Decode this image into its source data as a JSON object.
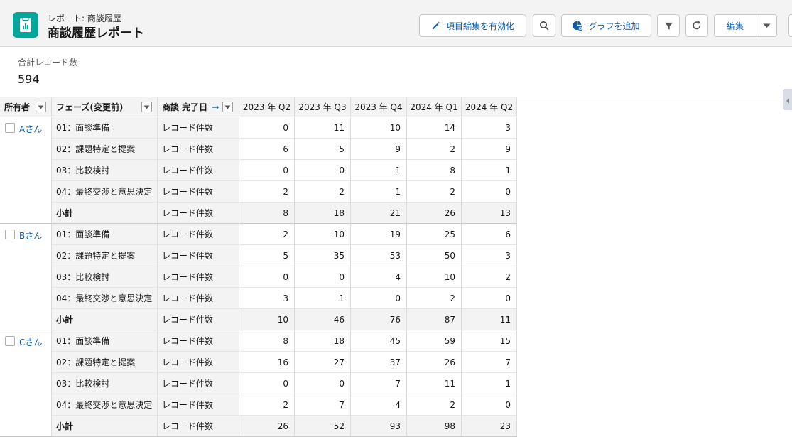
{
  "header": {
    "subtitle": "レポート: 商談履歴",
    "title": "商談履歴レポート",
    "edit_fields_label": "項目編集を有効化",
    "add_chart_label": "グラフを追加",
    "edit_label": "編集"
  },
  "summary": {
    "label": "合計レコード数",
    "value": "594"
  },
  "table": {
    "headers": {
      "owner": "所有者",
      "phase": "フェーズ(変更前)",
      "close_date": "商談 完了日",
      "quarters": [
        "2023 年 Q2",
        "2023 年 Q3",
        "2023 年 Q4",
        "2024 年 Q1",
        "2024 年 Q2"
      ]
    },
    "metric_label": "レコード件数",
    "subtotal_label": "小計",
    "groups": [
      {
        "owner": "Aさん",
        "rows": [
          {
            "phase": "01：面談準備",
            "values": [
              "0",
              "11",
              "10",
              "14",
              "3"
            ]
          },
          {
            "phase": "02：課題特定と提案",
            "values": [
              "6",
              "5",
              "9",
              "2",
              "9"
            ]
          },
          {
            "phase": "03：比較検討",
            "values": [
              "0",
              "0",
              "1",
              "8",
              "1"
            ]
          },
          {
            "phase": "04：最終交渉と意思決定",
            "values": [
              "2",
              "2",
              "1",
              "2",
              "0"
            ]
          }
        ],
        "subtotal": [
          "8",
          "18",
          "21",
          "26",
          "13"
        ]
      },
      {
        "owner": "Bさん",
        "rows": [
          {
            "phase": "01：面談準備",
            "values": [
              "2",
              "10",
              "19",
              "25",
              "6"
            ]
          },
          {
            "phase": "02：課題特定と提案",
            "values": [
              "5",
              "35",
              "53",
              "50",
              "3"
            ]
          },
          {
            "phase": "03：比較検討",
            "values": [
              "0",
              "0",
              "4",
              "10",
              "2"
            ]
          },
          {
            "phase": "04：最終交渉と意思決定",
            "values": [
              "3",
              "1",
              "0",
              "2",
              "0"
            ]
          }
        ],
        "subtotal": [
          "10",
          "46",
          "76",
          "87",
          "11"
        ]
      },
      {
        "owner": "Cさん",
        "rows": [
          {
            "phase": "01：面談準備",
            "values": [
              "8",
              "18",
              "45",
              "59",
              "15"
            ]
          },
          {
            "phase": "02：課題特定と提案",
            "values": [
              "16",
              "27",
              "37",
              "26",
              "7"
            ]
          },
          {
            "phase": "03：比較検討",
            "values": [
              "0",
              "0",
              "7",
              "11",
              "1"
            ]
          },
          {
            "phase": "04：最終交渉と意思決定",
            "values": [
              "2",
              "7",
              "4",
              "2",
              "0"
            ]
          }
        ],
        "subtotal": [
          "26",
          "52",
          "93",
          "98",
          "23"
        ]
      }
    ]
  },
  "icons": {
    "app": "report-icon",
    "edit_fields": "pencil-icon",
    "search": "search-icon",
    "add_chart": "chart-add-icon",
    "filter": "filter-icon",
    "refresh": "refresh-icon",
    "edit_menu": "chevron-down-icon",
    "sort": "arrow-right-icon",
    "column_menu": "caret-down-icon"
  },
  "colors": {
    "accent": "#0b5cab",
    "app_icon": "#06a59a",
    "header_bg": "#f3f3f3"
  }
}
